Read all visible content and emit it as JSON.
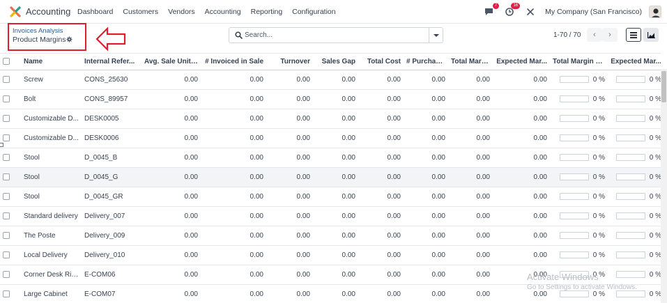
{
  "navbar": {
    "app_name": "Accounting",
    "menu": [
      "Dashboard",
      "Customers",
      "Vendors",
      "Accounting",
      "Reporting",
      "Configuration"
    ],
    "messages_badge": "7",
    "activity_badge": "16",
    "company": "My Company (San Francisco)"
  },
  "breadcrumb": {
    "parent": "Invoices Analysis",
    "current": "Product Margins"
  },
  "search": {
    "placeholder": "Search..."
  },
  "pager": {
    "range": "1-70 / 70"
  },
  "table": {
    "columns": [
      "Name",
      "Internal Refer...",
      "Avg. Sale Unit P...",
      "# Invoiced in Sale",
      "Turnover",
      "Sales Gap",
      "Total Cost",
      "# Purchased",
      "Total Margin",
      "Expected Mar...",
      "Total Margin Ra...",
      "Expected Mar..."
    ],
    "rows": [
      {
        "name": "Screw",
        "ref": "CONS_25630",
        "avg_sale": "0.00",
        "invoiced": "0.00",
        "turnover": "0.00",
        "sales_gap": "0.00",
        "total_cost": "0.00",
        "purchased": "0.00",
        "total_margin": "0.00",
        "expected_margin": "0.00",
        "margin_rate": "0 %",
        "margin_rate_value": 0,
        "expected_rate": "0 %",
        "expected_rate_value": 0
      },
      {
        "name": "Bolt",
        "ref": "CONS_89957",
        "avg_sale": "0.00",
        "invoiced": "0.00",
        "turnover": "0.00",
        "sales_gap": "0.00",
        "total_cost": "0.00",
        "purchased": "0.00",
        "total_margin": "0.00",
        "expected_margin": "0.00",
        "margin_rate": "0 %",
        "margin_rate_value": 0,
        "expected_rate": "0 %",
        "expected_rate_value": 0
      },
      {
        "name": "Customizable D...",
        "ref": "DESK0005",
        "avg_sale": "0.00",
        "invoiced": "0.00",
        "turnover": "0.00",
        "sales_gap": "0.00",
        "total_cost": "0.00",
        "purchased": "0.00",
        "total_margin": "0.00",
        "expected_margin": "0.00",
        "margin_rate": "0 %",
        "margin_rate_value": 0,
        "expected_rate": "0 %",
        "expected_rate_value": 0
      },
      {
        "name": "Customizable D...",
        "ref": "DESK0006",
        "avg_sale": "0.00",
        "invoiced": "0.00",
        "turnover": "0.00",
        "sales_gap": "0.00",
        "total_cost": "0.00",
        "purchased": "0.00",
        "total_margin": "0.00",
        "expected_margin": "0.00",
        "margin_rate": "0 %",
        "margin_rate_value": 0,
        "expected_rate": "0 %",
        "expected_rate_value": 0
      },
      {
        "name": "Stool",
        "ref": "D_0045_B",
        "avg_sale": "0.00",
        "invoiced": "0.00",
        "turnover": "0.00",
        "sales_gap": "0.00",
        "total_cost": "0.00",
        "purchased": "0.00",
        "total_margin": "0.00",
        "expected_margin": "0.00",
        "margin_rate": "0 %",
        "margin_rate_value": 0,
        "expected_rate": "0 %",
        "expected_rate_value": 0
      },
      {
        "name": "Stool",
        "ref": "D_0045_G",
        "avg_sale": "0.00",
        "invoiced": "0.00",
        "turnover": "0.00",
        "sales_gap": "0.00",
        "total_cost": "0.00",
        "purchased": "0.00",
        "total_margin": "0.00",
        "expected_margin": "0.00",
        "margin_rate": "0 %",
        "margin_rate_value": 0,
        "expected_rate": "0 %",
        "expected_rate_value": 0
      },
      {
        "name": "Stool",
        "ref": "D_0045_GR",
        "avg_sale": "0.00",
        "invoiced": "0.00",
        "turnover": "0.00",
        "sales_gap": "0.00",
        "total_cost": "0.00",
        "purchased": "0.00",
        "total_margin": "0.00",
        "expected_margin": "0.00",
        "margin_rate": "0 %",
        "margin_rate_value": 0,
        "expected_rate": "0 %",
        "expected_rate_value": 0
      },
      {
        "name": "Standard delivery",
        "ref": "Delivery_007",
        "avg_sale": "0.00",
        "invoiced": "0.00",
        "turnover": "0.00",
        "sales_gap": "0.00",
        "total_cost": "0.00",
        "purchased": "0.00",
        "total_margin": "0.00",
        "expected_margin": "0.00",
        "margin_rate": "0 %",
        "margin_rate_value": 0,
        "expected_rate": "0 %",
        "expected_rate_value": 0
      },
      {
        "name": "The Poste",
        "ref": "Delivery_009",
        "avg_sale": "0.00",
        "invoiced": "0.00",
        "turnover": "0.00",
        "sales_gap": "0.00",
        "total_cost": "0.00",
        "purchased": "0.00",
        "total_margin": "0.00",
        "expected_margin": "0.00",
        "margin_rate": "0 %",
        "margin_rate_value": 0,
        "expected_rate": "0 %",
        "expected_rate_value": 0
      },
      {
        "name": "Local Delivery",
        "ref": "Delivery_010",
        "avg_sale": "0.00",
        "invoiced": "0.00",
        "turnover": "0.00",
        "sales_gap": "0.00",
        "total_cost": "0.00",
        "purchased": "0.00",
        "total_margin": "0.00",
        "expected_margin": "0.00",
        "margin_rate": "0 %",
        "margin_rate_value": 0,
        "expected_rate": "0 %",
        "expected_rate_value": 0
      },
      {
        "name": "Corner Desk Rig...",
        "ref": "E-COM06",
        "avg_sale": "0.00",
        "invoiced": "0.00",
        "turnover": "0.00",
        "sales_gap": "0.00",
        "total_cost": "0.00",
        "purchased": "0.00",
        "total_margin": "0.00",
        "expected_margin": "0.00",
        "margin_rate": "0 %",
        "margin_rate_value": 0,
        "expected_rate": "0 %",
        "expected_rate_value": 0
      },
      {
        "name": "Large Cabinet",
        "ref": "E-COM07",
        "avg_sale": "0.00",
        "invoiced": "0.00",
        "turnover": "0.00",
        "sales_gap": "0.00",
        "total_cost": "0.00",
        "purchased": "0.00",
        "total_margin": "0.00",
        "expected_margin": "0.00",
        "margin_rate": "0 %",
        "margin_rate_value": 0,
        "expected_rate": "0 %",
        "expected_rate_value": 0
      }
    ]
  },
  "watermark": {
    "line1": "Activate Windows",
    "line2": "Go to Settings to activate Windows."
  },
  "colors": {
    "accent": "#71639e",
    "highlight_box": "#e11d2e",
    "badge": "#e11d48",
    "breadcrumb_link": "#2e5f8a"
  },
  "icons": [
    "odoo-logo-icon",
    "chat-icon",
    "clock-icon",
    "tools-icon",
    "avatar",
    "gear-icon",
    "search-icon",
    "chevron-left-icon",
    "chevron-right-icon",
    "list-view-icon",
    "graph-view-icon",
    "red-arrow-annotation"
  ]
}
